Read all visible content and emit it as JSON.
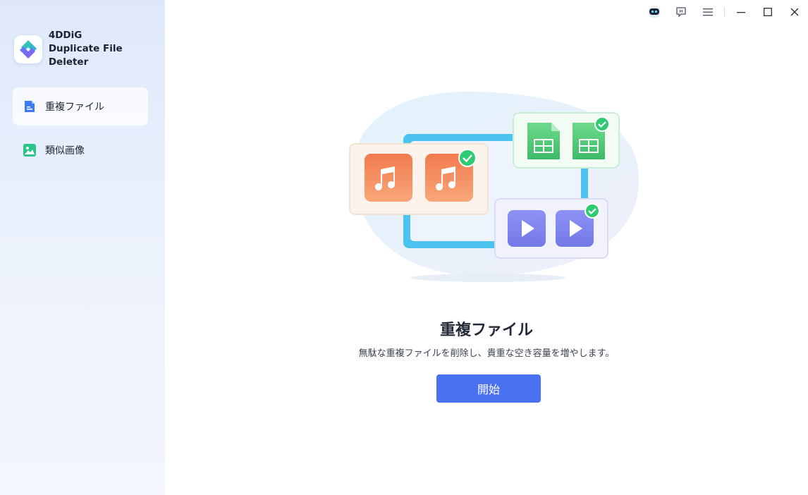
{
  "app": {
    "name_line1": "4DDiG",
    "name_line2": "Duplicate File Deleter"
  },
  "sidebar": {
    "items": [
      {
        "label": "重複ファイル",
        "icon": "document-icon",
        "active": true
      },
      {
        "label": "類似画像",
        "icon": "image-icon",
        "active": false
      }
    ]
  },
  "titlebar": {
    "buttons": [
      "robot-icon",
      "feedback-icon",
      "menu-icon",
      "minimize-icon",
      "maximize-icon",
      "close-icon"
    ]
  },
  "main": {
    "title": "重複ファイル",
    "subtitle": "無駄な重複ファイルを削除し、貴重な空き容量を増やします。",
    "start_label": "開始"
  },
  "colors": {
    "accent": "#4a72f0",
    "doc_icon": "#3d7bf5",
    "image_icon": "#2bc48a",
    "music_card": "#f4895c",
    "sheet_card": "#3fbf6b",
    "video_card": "#7c82f2"
  }
}
